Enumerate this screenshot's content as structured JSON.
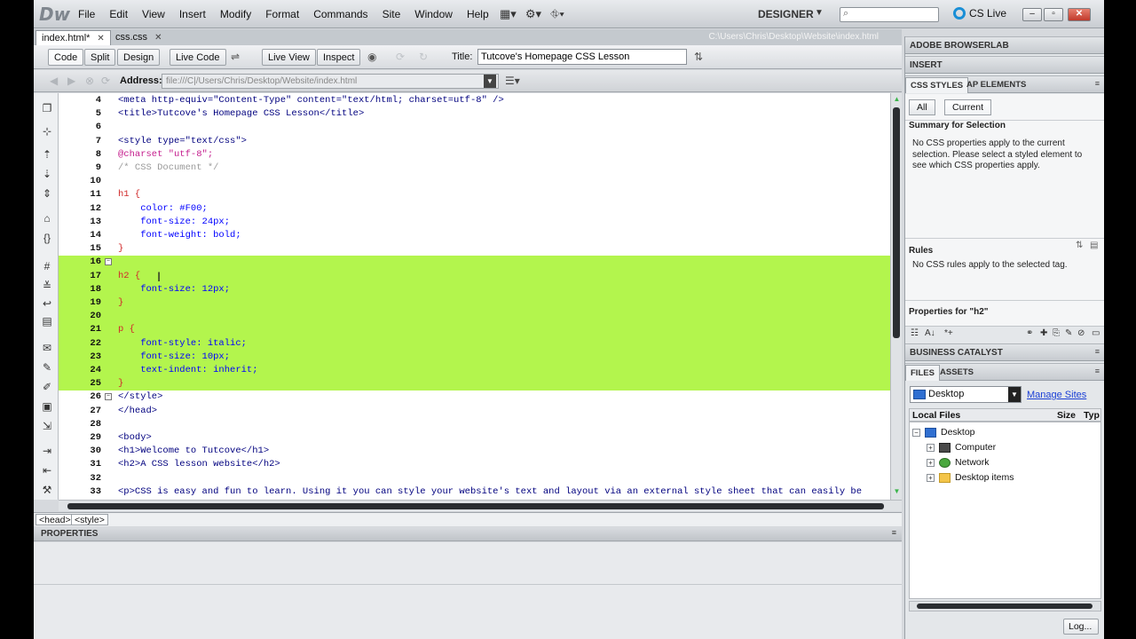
{
  "app": {
    "logo": "Dw",
    "menu": [
      "File",
      "Edit",
      "View",
      "Insert",
      "Modify",
      "Format",
      "Commands",
      "Site",
      "Window",
      "Help"
    ],
    "workspace": "DESIGNER",
    "cslive": "CS Live"
  },
  "tabs": [
    {
      "label": "index.html*",
      "active": true
    },
    {
      "label": "css.css",
      "active": false
    }
  ],
  "doc_path": "C:\\Users\\Chris\\Desktop\\Website\\index.html",
  "toolbar": {
    "code": "Code",
    "split": "Split",
    "design": "Design",
    "live_code": "Live Code",
    "live_view": "Live View",
    "inspect": "Inspect",
    "title_label": "Title:",
    "title_value": "Tutcove's Homepage CSS Lesson"
  },
  "address": {
    "label": "Address:",
    "value": "file:///C|/Users/Chris/Desktop/Website/index.html"
  },
  "code_lines": [
    {
      "n": "4",
      "t": "<meta http-equiv=\"Content-Type\" content=\"text/html; charset=utf-8\" />",
      "c": "c-tag"
    },
    {
      "n": "5",
      "t": "<title>Tutcove's Homepage CSS Lesson</title>",
      "c": "c-tag"
    },
    {
      "n": "6",
      "t": "",
      "c": "c-txt"
    },
    {
      "n": "7",
      "t": "<style type=\"text/css\">",
      "c": "c-tag"
    },
    {
      "n": "8",
      "t": "@charset \"utf-8\";",
      "c": "c-at"
    },
    {
      "n": "9",
      "t": "/* CSS Document */",
      "c": "c-com"
    },
    {
      "n": "10",
      "t": "",
      "c": "c-txt"
    },
    {
      "n": "11",
      "t": "h1 {",
      "c": "c-sel"
    },
    {
      "n": "12",
      "t": "    color: #F00;",
      "c": "c-prop"
    },
    {
      "n": "13",
      "t": "    font-size: 24px;",
      "c": "c-prop"
    },
    {
      "n": "14",
      "t": "    font-weight: bold;",
      "c": "c-prop"
    },
    {
      "n": "15",
      "t": "}",
      "c": "c-sel"
    },
    {
      "n": "16",
      "t": "",
      "c": "c-txt",
      "hl": true,
      "fold": "−"
    },
    {
      "n": "17",
      "t": "h2 {",
      "c": "c-sel",
      "hl": true
    },
    {
      "n": "18",
      "t": "    font-size: 12px;",
      "c": "c-prop",
      "hl": true
    },
    {
      "n": "19",
      "t": "}",
      "c": "c-sel",
      "hl": true
    },
    {
      "n": "20",
      "t": "",
      "c": "c-txt",
      "hl": true
    },
    {
      "n": "21",
      "t": "p {",
      "c": "c-sel",
      "hl": true
    },
    {
      "n": "22",
      "t": "    font-style: italic;",
      "c": "c-prop",
      "hl": true
    },
    {
      "n": "23",
      "t": "    font-size: 10px;",
      "c": "c-prop",
      "hl": true
    },
    {
      "n": "24",
      "t": "    text-indent: inherit;",
      "c": "c-prop",
      "hl": true
    },
    {
      "n": "25",
      "t": "}",
      "c": "c-sel",
      "hl": true
    },
    {
      "n": "26",
      "t": "</style>",
      "c": "c-tag",
      "fold": "−"
    },
    {
      "n": "27",
      "t": "</head>",
      "c": "c-tag"
    },
    {
      "n": "28",
      "t": "",
      "c": "c-txt"
    },
    {
      "n": "29",
      "t": "<body>",
      "c": "c-tag"
    },
    {
      "n": "30",
      "t": "<h1>Welcome to Tutcove</h1>",
      "c": "c-tag"
    },
    {
      "n": "31",
      "t": "<h2>A CSS lesson website</h2>",
      "c": "c-tag"
    },
    {
      "n": "32",
      "t": "",
      "c": "c-txt"
    },
    {
      "n": "33",
      "t": "<p>CSS is easy and fun to learn. Using it you can style your website's text and layout via an external style sheet that can easily be",
      "c": "c-tag"
    }
  ],
  "tag_selector": [
    "<head>",
    "<style>"
  ],
  "properties_title": "PROPERTIES",
  "panels": {
    "browserlab": "ADOBE BROWSERLAB",
    "insert": "INSERT",
    "css_tab": "CSS STYLES",
    "ap_tab": "AP ELEMENTS",
    "all": "All",
    "current": "Current",
    "summary_title": "Summary for Selection",
    "summary_text": "No CSS properties apply to the current selection.  Please select a styled element to see which CSS properties apply.",
    "rules_title": "Rules",
    "rules_text": "No CSS rules apply to the selected tag.",
    "props_for": "Properties for \"h2\"",
    "business_catalyst": "BUSINESS CATALYST",
    "files_tab": "FILES",
    "assets_tab": "ASSETS",
    "site": "Desktop",
    "manage_sites": "Manage Sites",
    "local_files": "Local Files",
    "size": "Size",
    "type": "Typ",
    "tree": [
      {
        "label": "Desktop",
        "level": 0,
        "exp": "−",
        "icon": "ico-desktop"
      },
      {
        "label": "Computer",
        "level": 1,
        "exp": "+",
        "icon": "ico-computer"
      },
      {
        "label": "Network",
        "level": 1,
        "exp": "+",
        "icon": "ico-network"
      },
      {
        "label": "Desktop items",
        "level": 1,
        "exp": "+",
        "icon": "ico-folder"
      }
    ],
    "log": "Log..."
  }
}
